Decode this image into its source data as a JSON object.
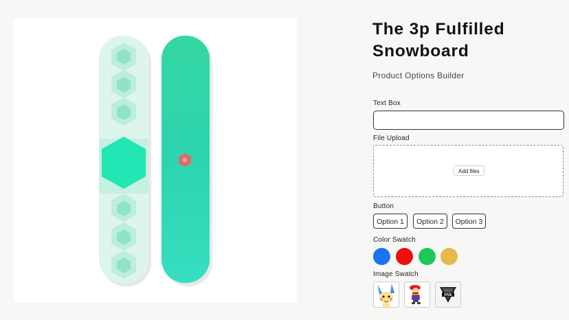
{
  "product": {
    "title": "The 3p Fulfilled Snowboard",
    "subtitle": "Product Options Builder",
    "image_alt": "snowboard"
  },
  "options": {
    "text_box": {
      "label": "Text Box",
      "value": "",
      "placeholder": ""
    },
    "file_upload": {
      "label": "File Upload",
      "button_label": "Add files"
    },
    "button": {
      "label": "Button",
      "items": [
        "Option 1",
        "Option 2",
        "Option 3"
      ]
    },
    "color_swatch": {
      "label": "Color Swatch",
      "colors": [
        "#1a73f0",
        "#ef0f0f",
        "#1cc95a",
        "#e8b94a"
      ]
    },
    "image_swatch": {
      "label": "Image Swatch",
      "items": [
        "electric-mouse-character",
        "plumber-character",
        "five-v-logo"
      ]
    }
  },
  "colors": {
    "board_teal": "#2fd6a8",
    "board_mint": "#dff6ec",
    "accent_red": "#e06a6a"
  }
}
